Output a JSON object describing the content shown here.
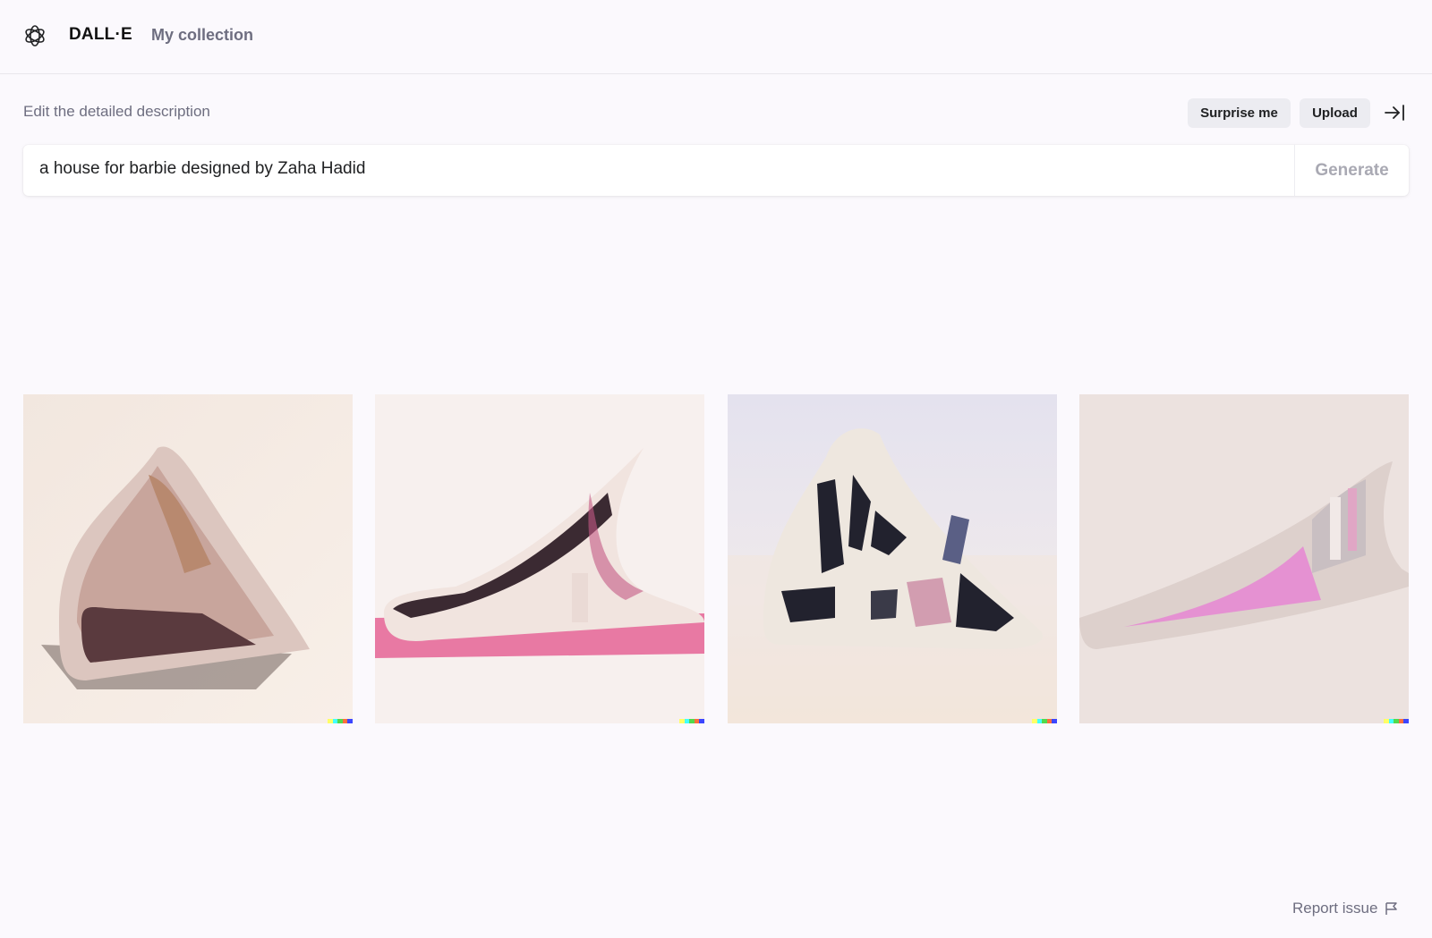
{
  "header": {
    "brand": "DALL·E",
    "nav_collection": "My collection",
    "logo_icon": "openai-logo-icon"
  },
  "editor": {
    "label": "Edit the detailed description",
    "surprise_label": "Surprise me",
    "upload_label": "Upload",
    "collapse_icon": "arrow-right-bar-icon",
    "prompt_value": "a house for barbie designed by Zaha Hadid",
    "generate_label": "Generate"
  },
  "results": {
    "images": [
      {
        "description": "pink curved model house"
      },
      {
        "description": "white ramp house on pink base"
      },
      {
        "description": "white house with dark windows"
      },
      {
        "description": "translucent pink wedge house"
      }
    ]
  },
  "footer": {
    "report_label": "Report issue",
    "report_icon": "flag-icon"
  },
  "colors": {
    "background": "#fbf9fd",
    "muted_text": "#6e6e80",
    "pill_bg": "#ececf1",
    "watermark": [
      "#ffff66",
      "#42ffff",
      "#51da4c",
      "#ff6e3c",
      "#3c46ff"
    ]
  }
}
